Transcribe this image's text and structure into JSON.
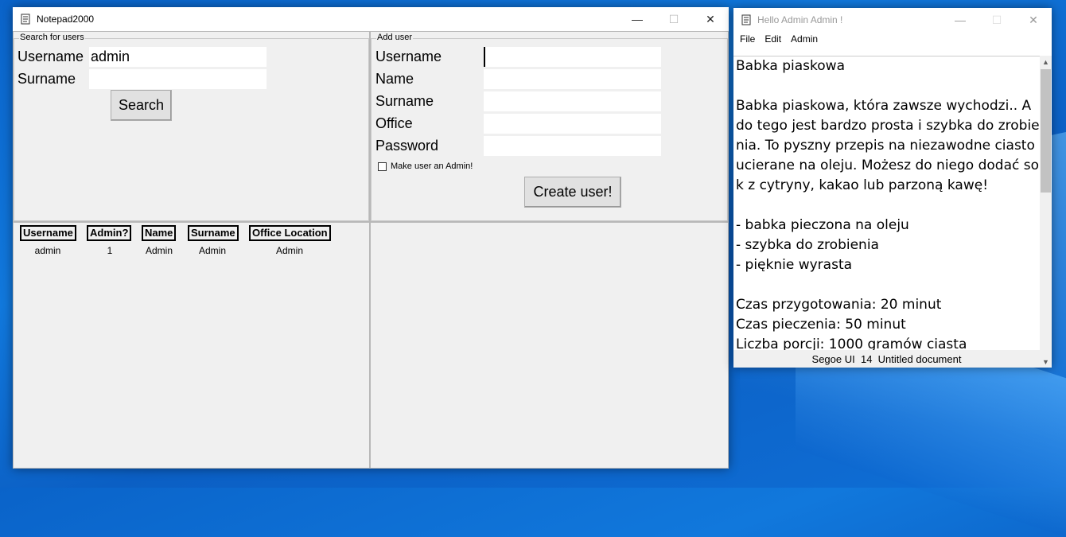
{
  "main_window": {
    "title": "Notepad2000",
    "search_group": {
      "title": "Search for users",
      "username_label": "Username",
      "username_value": "admin",
      "surname_label": "Surname",
      "surname_value": "",
      "search_button": "Search"
    },
    "add_group": {
      "title": "Add user",
      "username_label": "Username",
      "name_label": "Name",
      "surname_label": "Surname",
      "office_label": "Office",
      "password_label": "Password",
      "admin_checkbox_label": "Make user an Admin!",
      "admin_checked": false,
      "create_button": "Create user!"
    },
    "results_table": {
      "headers": [
        "Username",
        "Admin?",
        "Name",
        "Surname",
        "Office Location"
      ],
      "rows": [
        [
          "admin",
          "1",
          "Admin",
          "Admin",
          "Admin"
        ]
      ]
    }
  },
  "editor_window": {
    "title": "Hello Admin Admin !",
    "menu": [
      "File",
      "Edit",
      "Admin"
    ],
    "text": "Babka piaskowa\n\nBabka piaskowa, która zawsze wychodzi.. A do tego jest bardzo prosta i szybka do zrobienia. To pyszny przepis na niezawodne ciasto ucierane na oleju. Możesz do niego dodać sok z cytryny, kakao lub parzoną kawę!\n\n- babka pieczona na oleju\n- szybka do zrobienia\n- pięknie wyrasta\n\nCzas przygotowania: 20 minut\nCzas pieczenia: 50 minut\nLiczba porcji: 1000 gramów ciasta",
    "status": {
      "font": "Segoe UI",
      "size": "14",
      "document": "Untitled document"
    }
  }
}
